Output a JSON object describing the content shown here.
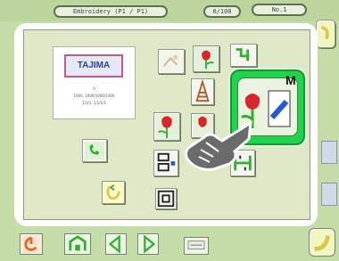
{
  "header": {
    "title": "Embroidery  (P1 / P1)",
    "counter": "0/108",
    "indicator": "No.1"
  },
  "logo_card": {
    "brand": "TAJIMA",
    "line1": "0",
    "line2": "1000, 1000/1000/1000",
    "line3": "1/1/1, 1/1/1/1"
  },
  "selected_button": {
    "label": "M"
  },
  "colors": {
    "background": "#c4dca8",
    "panel": "#dfe8c6",
    "selected_accent": "#1fd34a",
    "icon_green": "#2fb12f",
    "icon_red": "#d8262b",
    "icon_blue": "#2358d8",
    "icon_yellow": "#d3c94a"
  },
  "icons": [
    "flower-icon",
    "color-change-icon",
    "hoop-icon",
    "pattern-icon",
    "phone-icon",
    "recycle-icon",
    "frame-move-icon",
    "scan-icon",
    "power-icon",
    "home-icon",
    "previous-icon",
    "next-icon",
    "setting-icon",
    "return-icon",
    "pointing-hand-icon"
  ]
}
